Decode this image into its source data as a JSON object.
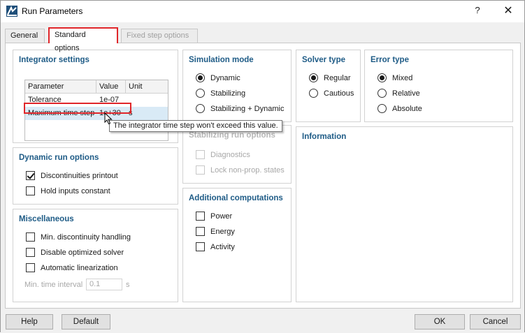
{
  "window": {
    "title": "Run Parameters",
    "help_glyph": "?",
    "close_glyph": "✕"
  },
  "tabs": [
    {
      "label": "General",
      "state": "normal"
    },
    {
      "label": "Standard options",
      "state": "active"
    },
    {
      "label": "Fixed step options",
      "state": "disabled"
    }
  ],
  "integrator": {
    "title": "Integrator settings",
    "columns": [
      "Parameter",
      "Value",
      "Unit"
    ],
    "rows": [
      {
        "parameter": "Tolerance",
        "value": "1e-07",
        "unit": ""
      },
      {
        "parameter": "Maximum time step",
        "value": "1e+30",
        "unit": "s"
      }
    ],
    "tooltip": "The integrator time step won't exceed this value."
  },
  "dynamic_run": {
    "title": "Dynamic run options",
    "items": [
      {
        "label": "Discontinuities printout",
        "checked": true
      },
      {
        "label": "Hold inputs constant",
        "checked": false
      }
    ]
  },
  "misc": {
    "title": "Miscellaneous",
    "items": [
      {
        "label": "Min. discontinuity handling",
        "checked": false
      },
      {
        "label": "Disable optimized solver",
        "checked": false
      },
      {
        "label": "Automatic linearization",
        "checked": false
      }
    ],
    "min_time_label": "Min. time interval",
    "min_time_value": "0.1",
    "min_time_unit": "s"
  },
  "sim_mode": {
    "title": "Simulation mode",
    "options": [
      {
        "label": "Dynamic",
        "selected": true
      },
      {
        "label": "Stabilizing",
        "selected": false
      },
      {
        "label": "Stabilizing + Dynamic",
        "selected": false
      }
    ]
  },
  "stab_run": {
    "title": "Stabilizing run options",
    "items": [
      {
        "label": "Diagnostics",
        "checked": false
      },
      {
        "label": "Lock non-prop. states",
        "checked": false
      }
    ]
  },
  "additional": {
    "title": "Additional computations",
    "items": [
      {
        "label": "Power",
        "checked": false
      },
      {
        "label": "Energy",
        "checked": false
      },
      {
        "label": "Activity",
        "checked": false
      }
    ]
  },
  "solver": {
    "title": "Solver type",
    "options": [
      {
        "label": "Regular",
        "selected": true
      },
      {
        "label": "Cautious",
        "selected": false
      }
    ]
  },
  "error_type": {
    "title": "Error type",
    "options": [
      {
        "label": "Mixed",
        "selected": true
      },
      {
        "label": "Relative",
        "selected": false
      },
      {
        "label": "Absolute",
        "selected": false
      }
    ]
  },
  "information": {
    "title": "Information"
  },
  "buttons": {
    "help": "Help",
    "default": "Default",
    "ok": "OK",
    "cancel": "Cancel"
  },
  "colors": {
    "group_title": "#1e5b86",
    "highlight_red": "#e0262a",
    "selected_row": "#d9eaf6"
  }
}
